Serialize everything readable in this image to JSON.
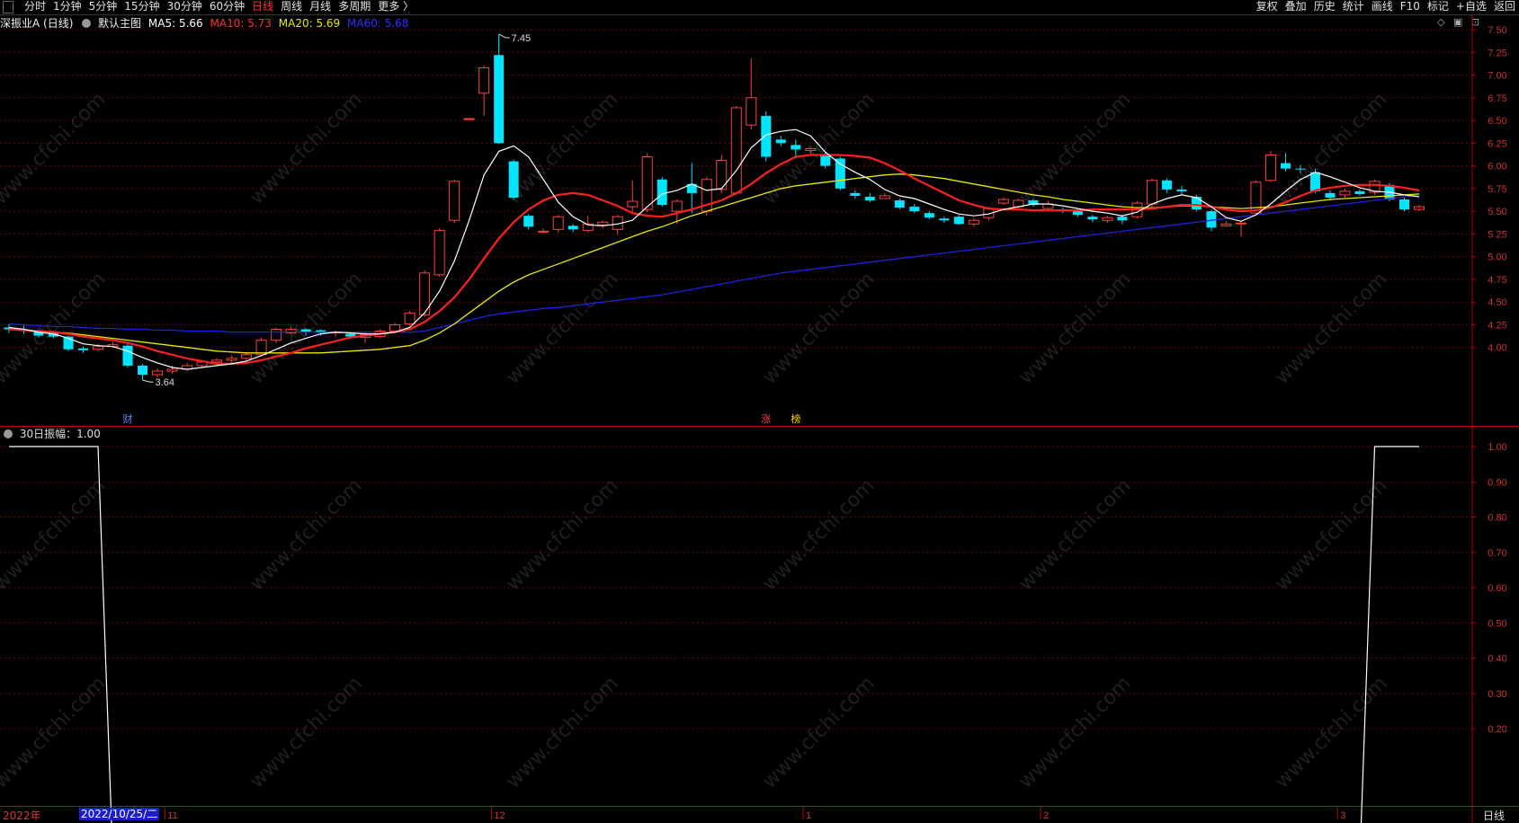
{
  "toolbar": {
    "left_items": [
      "分时",
      "1分钟",
      "5分钟",
      "15分钟",
      "30分钟",
      "60分钟",
      "日线",
      "周线",
      "月线",
      "多周期",
      "更多 〉"
    ],
    "active_item": "日线",
    "right_items": [
      "复权",
      "叠加",
      "历史",
      "统计",
      "画线",
      "F10",
      "标记",
      "+自选",
      "返回"
    ]
  },
  "main_chart": {
    "title": "深振业A (日线)",
    "indicator_name": "默认主图",
    "ma5_label": "MA5: 5.66",
    "ma10_label": "MA10: 5.73",
    "ma20_label": "MA20: 5.69",
    "ma60_label": "MA60: 5.68",
    "colors": {
      "ma5": "#ffffff",
      "ma10": "#ff2020",
      "ma20": "#e8e800",
      "ma60": "#2020dd",
      "up": "#ff4040",
      "down": "#00e5ff"
    },
    "y_ticks": [
      "7.50",
      "7.25",
      "7.00",
      "6.75",
      "6.50",
      "6.25",
      "6.00",
      "5.75",
      "5.50",
      "5.25",
      "5.00",
      "4.75",
      "4.50",
      "4.25",
      "4.00"
    ],
    "high_annotation": "7.45",
    "low_annotation": "3.64",
    "markers": [
      "财",
      "涨",
      "榜"
    ],
    "watermark": "www.cfchi.com"
  },
  "sub_chart": {
    "title": "30日振幅：1.00",
    "y_ticks": [
      "1.00",
      "0.90",
      "0.80",
      "0.70",
      "0.60",
      "0.50",
      "0.40",
      "0.30",
      "0.20"
    ]
  },
  "bottom": {
    "year": "2022年",
    "selected_date": "2022/10/25/二",
    "month_labels": [
      "11",
      "12",
      "1",
      "2",
      "3"
    ],
    "period_button": "日线"
  },
  "chart_data": {
    "type": "candlestick",
    "candles": [
      [
        4.22,
        4.2,
        4.26,
        4.16
      ],
      [
        4.2,
        4.18,
        4.24,
        4.15
      ],
      [
        4.18,
        4.13,
        4.2,
        4.11
      ],
      [
        4.16,
        4.12,
        4.18,
        4.1
      ],
      [
        4.12,
        3.98,
        4.13,
        3.96
      ],
      [
        3.99,
        3.97,
        4.01,
        3.94
      ],
      [
        3.98,
        4.01,
        4.04,
        3.96
      ],
      [
        4.01,
        4.03,
        4.06,
        3.99
      ],
      [
        4.02,
        3.8,
        4.04,
        3.78
      ],
      [
        3.8,
        3.7,
        3.82,
        3.64
      ],
      [
        3.7,
        3.74,
        3.77,
        3.67
      ],
      [
        3.74,
        3.76,
        3.8,
        3.71
      ],
      [
        3.76,
        3.8,
        3.83,
        3.74
      ],
      [
        3.8,
        3.84,
        3.86,
        3.78
      ],
      [
        3.84,
        3.86,
        3.88,
        3.81
      ],
      [
        3.86,
        3.88,
        3.91,
        3.83
      ],
      [
        3.88,
        3.92,
        3.95,
        3.86
      ],
      [
        3.92,
        4.08,
        4.11,
        3.9
      ],
      [
        4.08,
        4.2,
        4.22,
        4.05
      ],
      [
        4.16,
        4.2,
        4.23,
        4.14
      ],
      [
        4.2,
        4.17,
        4.21,
        4.13
      ],
      [
        4.19,
        4.16,
        4.2,
        4.13
      ],
      [
        4.16,
        4.17,
        4.19,
        4.12
      ],
      [
        4.15,
        4.12,
        4.17,
        4.1
      ],
      [
        4.11,
        4.14,
        4.17,
        4.05
      ],
      [
        4.12,
        4.18,
        4.2,
        4.1
      ],
      [
        4.18,
        4.25,
        4.27,
        4.16
      ],
      [
        4.26,
        4.38,
        4.4,
        4.24
      ],
      [
        4.36,
        4.82,
        4.85,
        4.34
      ],
      [
        4.8,
        5.29,
        5.31,
        4.78
      ],
      [
        5.4,
        5.83,
        5.85,
        5.37
      ],
      [
        6.52,
        6.52,
        6.52,
        6.52
      ],
      [
        6.8,
        7.08,
        7.1,
        6.55
      ],
      [
        7.22,
        6.25,
        7.45,
        6.24
      ],
      [
        6.05,
        5.65,
        6.07,
        5.63
      ],
      [
        5.45,
        5.33,
        5.47,
        5.3
      ],
      [
        5.28,
        5.28,
        5.31,
        5.26
      ],
      [
        5.3,
        5.44,
        5.46,
        5.27
      ],
      [
        5.34,
        5.3,
        5.36,
        5.27
      ],
      [
        5.29,
        5.36,
        5.45,
        5.27
      ],
      [
        5.35,
        5.38,
        5.4,
        5.31
      ],
      [
        5.3,
        5.44,
        5.46,
        5.24
      ],
      [
        5.55,
        5.61,
        5.84,
        5.47
      ],
      [
        5.52,
        6.1,
        6.14,
        5.49
      ],
      [
        5.85,
        5.57,
        5.88,
        5.55
      ],
      [
        5.5,
        5.61,
        5.63,
        5.36
      ],
      [
        5.8,
        5.7,
        6.03,
        5.48
      ],
      [
        5.5,
        5.85,
        5.88,
        5.45
      ],
      [
        5.74,
        6.06,
        6.12,
        5.7
      ],
      [
        5.7,
        6.64,
        6.66,
        5.68
      ],
      [
        6.45,
        6.75,
        7.18,
        6.4
      ],
      [
        6.55,
        6.1,
        6.6,
        6.05
      ],
      [
        6.29,
        6.25,
        6.33,
        6.22
      ],
      [
        6.23,
        6.18,
        6.29,
        6.08
      ],
      [
        6.17,
        6.19,
        6.21,
        6.13
      ],
      [
        6.13,
        6.0,
        6.15,
        5.97
      ],
      [
        6.08,
        5.75,
        6.1,
        5.73
      ],
      [
        5.7,
        5.67,
        5.73,
        5.64
      ],
      [
        5.66,
        5.62,
        5.7,
        5.6
      ],
      [
        5.64,
        5.67,
        5.7,
        5.64
      ],
      [
        5.62,
        5.54,
        5.64,
        5.52
      ],
      [
        5.55,
        5.5,
        5.58,
        5.48
      ],
      [
        5.48,
        5.43,
        5.5,
        5.41
      ],
      [
        5.42,
        5.4,
        5.44,
        5.37
      ],
      [
        5.44,
        5.36,
        5.46,
        5.35
      ],
      [
        5.36,
        5.4,
        5.43,
        5.33
      ],
      [
        5.43,
        5.53,
        5.55,
        5.4
      ],
      [
        5.59,
        5.63,
        5.65,
        5.57
      ],
      [
        5.55,
        5.62,
        5.64,
        5.52
      ],
      [
        5.62,
        5.57,
        5.64,
        5.55
      ],
      [
        5.53,
        5.58,
        5.62,
        5.5
      ],
      [
        5.52,
        5.5,
        5.54,
        5.48
      ],
      [
        5.5,
        5.46,
        5.52,
        5.44
      ],
      [
        5.44,
        5.41,
        5.46,
        5.38
      ],
      [
        5.4,
        5.43,
        5.45,
        5.37
      ],
      [
        5.44,
        5.4,
        5.46,
        5.36
      ],
      [
        5.44,
        5.59,
        5.61,
        5.42
      ],
      [
        5.58,
        5.84,
        5.86,
        5.55
      ],
      [
        5.84,
        5.74,
        5.86,
        5.7
      ],
      [
        5.74,
        5.72,
        5.78,
        5.68
      ],
      [
        5.66,
        5.52,
        5.68,
        5.5
      ],
      [
        5.5,
        5.32,
        5.52,
        5.28
      ],
      [
        5.34,
        5.36,
        5.39,
        5.33
      ],
      [
        5.36,
        5.37,
        5.39,
        5.22
      ],
      [
        5.48,
        5.82,
        5.84,
        5.45
      ],
      [
        5.84,
        6.12,
        6.16,
        5.82
      ],
      [
        6.03,
        5.97,
        6.14,
        5.94
      ],
      [
        5.97,
        5.96,
        6.01,
        5.92
      ],
      [
        5.93,
        5.72,
        5.97,
        5.7
      ],
      [
        5.7,
        5.65,
        5.73,
        5.62
      ],
      [
        5.68,
        5.72,
        5.75,
        5.65
      ],
      [
        5.72,
        5.69,
        5.74,
        5.67
      ],
      [
        5.71,
        5.83,
        5.85,
        5.68
      ],
      [
        5.79,
        5.63,
        5.81,
        5.61
      ],
      [
        5.63,
        5.52,
        5.65,
        5.5
      ],
      [
        5.52,
        5.55,
        5.57,
        5.5
      ]
    ],
    "ma5": [
      4.22,
      4.2,
      4.17,
      4.15,
      4.1,
      4.04,
      4.02,
      4.01,
      3.96,
      3.89,
      3.83,
      3.78,
      3.76,
      3.78,
      3.8,
      3.82,
      3.85,
      3.91,
      3.98,
      4.05,
      4.1,
      4.15,
      4.17,
      4.16,
      4.15,
      4.15,
      4.17,
      4.22,
      4.38,
      4.62,
      4.95,
      5.4,
      5.9,
      6.16,
      6.22,
      6.1,
      5.85,
      5.6,
      5.44,
      5.35,
      5.34,
      5.36,
      5.4,
      5.55,
      5.69,
      5.73,
      5.8,
      5.73,
      5.75,
      5.95,
      6.2,
      6.34,
      6.38,
      6.4,
      6.33,
      6.15,
      6.02,
      5.93,
      5.85,
      5.74,
      5.67,
      5.64,
      5.58,
      5.52,
      5.47,
      5.45,
      5.47,
      5.52,
      5.55,
      5.58,
      5.58,
      5.56,
      5.53,
      5.5,
      5.48,
      5.45,
      5.49,
      5.58,
      5.64,
      5.68,
      5.65,
      5.55,
      5.43,
      5.39,
      5.46,
      5.58,
      5.72,
      5.85,
      5.93,
      5.88,
      5.82,
      5.76,
      5.72,
      5.71,
      5.68,
      5.66
    ],
    "ma10": [
      4.2,
      4.19,
      4.18,
      4.17,
      4.15,
      4.12,
      4.1,
      4.08,
      4.05,
      4.01,
      3.96,
      3.92,
      3.88,
      3.85,
      3.82,
      3.82,
      3.83,
      3.86,
      3.9,
      3.94,
      3.99,
      4.03,
      4.07,
      4.11,
      4.13,
      4.15,
      4.17,
      4.2,
      4.28,
      4.4,
      4.55,
      4.75,
      4.98,
      5.2,
      5.38,
      5.52,
      5.62,
      5.68,
      5.7,
      5.68,
      5.62,
      5.56,
      5.48,
      5.45,
      5.44,
      5.48,
      5.52,
      5.57,
      5.62,
      5.7,
      5.8,
      5.92,
      6.02,
      6.1,
      6.12,
      6.12,
      6.12,
      6.11,
      6.09,
      6.03,
      5.95,
      5.86,
      5.78,
      5.7,
      5.62,
      5.57,
      5.53,
      5.52,
      5.52,
      5.51,
      5.51,
      5.51,
      5.51,
      5.52,
      5.52,
      5.52,
      5.52,
      5.53,
      5.55,
      5.57,
      5.57,
      5.55,
      5.52,
      5.5,
      5.51,
      5.54,
      5.6,
      5.67,
      5.73,
      5.76,
      5.78,
      5.79,
      5.79,
      5.78,
      5.76,
      5.73
    ],
    "ma20": [
      4.2,
      4.19,
      4.18,
      4.17,
      4.16,
      4.14,
      4.12,
      4.1,
      4.08,
      4.06,
      4.04,
      4.02,
      4.0,
      3.98,
      3.96,
      3.95,
      3.94,
      3.94,
      3.94,
      3.94,
      3.94,
      3.94,
      3.95,
      3.96,
      3.97,
      3.98,
      4.0,
      4.02,
      4.08,
      4.16,
      4.26,
      4.38,
      4.5,
      4.62,
      4.72,
      4.8,
      4.86,
      4.92,
      4.98,
      5.04,
      5.1,
      5.16,
      5.22,
      5.28,
      5.33,
      5.39,
      5.45,
      5.5,
      5.55,
      5.6,
      5.65,
      5.7,
      5.75,
      5.78,
      5.8,
      5.82,
      5.84,
      5.86,
      5.88,
      5.9,
      5.91,
      5.9,
      5.88,
      5.86,
      5.83,
      5.8,
      5.77,
      5.74,
      5.71,
      5.68,
      5.66,
      5.63,
      5.61,
      5.59,
      5.57,
      5.55,
      5.54,
      5.54,
      5.55,
      5.56,
      5.56,
      5.55,
      5.54,
      5.53,
      5.54,
      5.55,
      5.57,
      5.59,
      5.61,
      5.63,
      5.64,
      5.65,
      5.66,
      5.67,
      5.68,
      5.69
    ],
    "ma60": [
      4.26,
      4.25,
      4.24,
      4.23,
      4.23,
      4.22,
      4.21,
      4.21,
      4.2,
      4.2,
      4.19,
      4.19,
      4.18,
      4.18,
      4.18,
      4.17,
      4.17,
      4.17,
      4.17,
      4.17,
      4.17,
      4.17,
      4.17,
      4.17,
      4.17,
      4.17,
      4.17,
      4.17,
      4.18,
      4.22,
      4.26,
      4.3,
      4.34,
      4.37,
      4.39,
      4.41,
      4.43,
      4.44,
      4.46,
      4.48,
      4.5,
      4.52,
      4.54,
      4.56,
      4.58,
      4.61,
      4.64,
      4.67,
      4.7,
      4.73,
      4.76,
      4.79,
      4.82,
      4.84,
      4.86,
      4.88,
      4.9,
      4.92,
      4.94,
      4.96,
      4.98,
      5.0,
      5.02,
      5.04,
      5.06,
      5.08,
      5.1,
      5.12,
      5.14,
      5.16,
      5.18,
      5.2,
      5.22,
      5.24,
      5.26,
      5.28,
      5.3,
      5.32,
      5.34,
      5.36,
      5.38,
      5.4,
      5.42,
      5.44,
      5.46,
      5.48,
      5.5,
      5.52,
      5.54,
      5.56,
      5.58,
      5.6,
      5.62,
      5.64,
      5.66,
      5.68
    ],
    "amplitude30": [
      1,
      1,
      1,
      1,
      1,
      1,
      1,
      0,
      0,
      0,
      0,
      0,
      0,
      0,
      0,
      0,
      0,
      0,
      0,
      0,
      0,
      0,
      0,
      0,
      0,
      0,
      0,
      0,
      0,
      0,
      0,
      0,
      0,
      0,
      0,
      0,
      0,
      0,
      0,
      0,
      0,
      0,
      0,
      0,
      0,
      0,
      0,
      0,
      0,
      0,
      0,
      0,
      0,
      0,
      0,
      0,
      0,
      0,
      0,
      0,
      0,
      0,
      0,
      0,
      0,
      0,
      0,
      0,
      0,
      0,
      0,
      0,
      0,
      0,
      0,
      0,
      0,
      0,
      0,
      0,
      0,
      0,
      0,
      0,
      0,
      0,
      0,
      0,
      0,
      0,
      0,
      0,
      1,
      1,
      1,
      1
    ],
    "y_range_main": [
      3.55,
      7.6
    ],
    "y_range_sub": [
      0.0,
      1.05
    ]
  }
}
